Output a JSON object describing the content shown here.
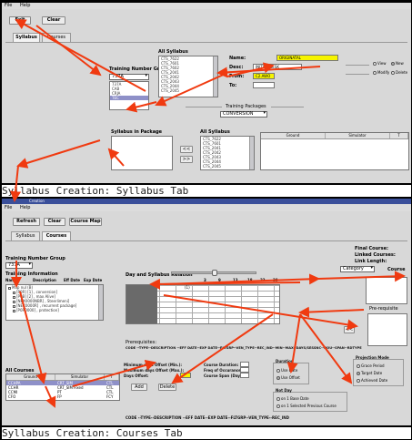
{
  "top": {
    "menu": [
      "File",
      "Help"
    ],
    "buttons": {
      "exit": "Exit",
      "clear": "Clear"
    },
    "tabs": [
      "Syllabus",
      "Courses"
    ],
    "training_number_group": {
      "label": "Training Number Group",
      "selected": "737A",
      "options": [
        "737A",
        "CAB",
        "CRJA",
        "TEC"
      ]
    },
    "all_syllabus": {
      "label": "All Syllabus",
      "items": [
        "CTS_7622",
        "CTS_7601",
        "CTS_7602",
        "CTS_2041",
        "CTS_2042",
        "CTS_2043",
        "CTS_2044",
        "CTS_2045"
      ]
    },
    "form": {
      "name_label": "Name:",
      "name_value": "ORIGINATAL",
      "desc_label": "Desc:",
      "desc_value": "INITIAL DESK",
      "from_label": "From:",
      "from_value": "C2.AWO",
      "to_label": "To:",
      "to_value": ""
    },
    "view_edit": {
      "view": "View",
      "new": "New",
      "modify": "Modify",
      "delete": "Delete"
    },
    "training_packages": {
      "label": "Training Packages",
      "selected": "CONVERSION"
    },
    "syllabus_in_package_label": "Syllabus in Package",
    "move_buttons": {
      "add": "<<",
      "remove": ">>"
    },
    "all_syllabus_2": {
      "label": "All Syllabus",
      "items": [
        "CTS_7622",
        "CTS_7601",
        "CTS_2041",
        "CTS_2042",
        "CTS_2043",
        "CTS_2044",
        "CTS_2045"
      ]
    },
    "package_table": {
      "columns": [
        "Ground",
        "Simulator",
        "T"
      ]
    },
    "caption": "Syllabus Creation: Syllabus Tab"
  },
  "bottom": {
    "window_title": "Creation",
    "menu": [
      "File",
      "Help"
    ],
    "buttons": {
      "refresh": "Refresh",
      "clear": "Clear",
      "course_map": "Course Map"
    },
    "tabs": [
      "Syllabus",
      "Courses"
    ],
    "training_group_label": "Training Number Group",
    "training_group_selected": "737A",
    "training_info_label": "Training Information",
    "tree_headers": [
      "Name",
      "Description",
      "Eff Date",
      "Exp Date"
    ],
    "tree_items": [
      "Map nul (B)",
      "[P0R] [1] , conversion]",
      "[P0B] [2] , max Alive]",
      "[NEX0000NBR] , Steerlimeni]",
      "[NEX0000R] , recurrent package]",
      "[P0R0000] , protection]"
    ],
    "day_syllabus_label": "Day and Syllabus Relation",
    "day_ticks": [
      "3",
      "9",
      "13",
      "18",
      "23",
      "28"
    ],
    "grid_header": "(1)",
    "final_course": {
      "final": "Final Course:",
      "linked": "Linked Courses:",
      "link_length": "Link Length:",
      "category": "Category",
      "course": "Course"
    },
    "prerequisites_label": "Pre-requisite",
    "prereq_list_label": "Prerequisites:",
    "prereq_columns": "CODE  --TYPE--DESCRIPTION  --EFF DATE--EXP DATE--FLTGRP--VEN_TYPE--REC_IND--MIN--MAX--DAYS/SESSNC--HOU--SPAN--RDTYPE",
    "all_courses": {
      "label": "All Courses",
      "columns": [
        "Ground",
        "Simulator",
        "T"
      ],
      "rows": [
        [
          "CCHPA",
          "CRT_SIM",
          "CTL"
        ],
        [
          "CCHR",
          "CRT_SIM Fixed",
          "CTL"
        ],
        [
          "CCMI",
          "PT",
          "CTL"
        ],
        [
          "CFO",
          "FP",
          "FCY"
        ]
      ]
    },
    "minimum": {
      "min_offset": "Minimum days Offset (Min.):",
      "max_offset": "Maximum days Offset (Max.):",
      "days_off": "Days Offset:",
      "add": "Add",
      "delete": "Delete"
    },
    "course_duration": {
      "duration": "Course Duration:",
      "freq": "Freq of Occurance:",
      "span": "Course Span (Days):"
    },
    "duration_group": {
      "label": "Duration",
      "opt1": "Use Date",
      "opt2": "Use Offset"
    },
    "projection_group": {
      "label": "Projection Mode",
      "opt1": "Grace Period",
      "opt2": "Target Date",
      "opt3": "Achieved Date"
    },
    "not_day_group": {
      "label": "Not Day",
      "opt1": "on 1 Base Date",
      "opt2": "on 1 Selected Previous Course"
    },
    "footer_columns": "CODE  --TYPE--DESCRIPTION  --EFF DATE--EXP DATE--FLTGRP--VEN_TYPE--REC_IND",
    "caption": "Syllabus Creation: Courses Tab"
  },
  "colors": {
    "highlight_yellow": "#f6f400",
    "selection": "#8e90c8",
    "arrow": "#f03a10",
    "panel": "#d8d8d8"
  }
}
